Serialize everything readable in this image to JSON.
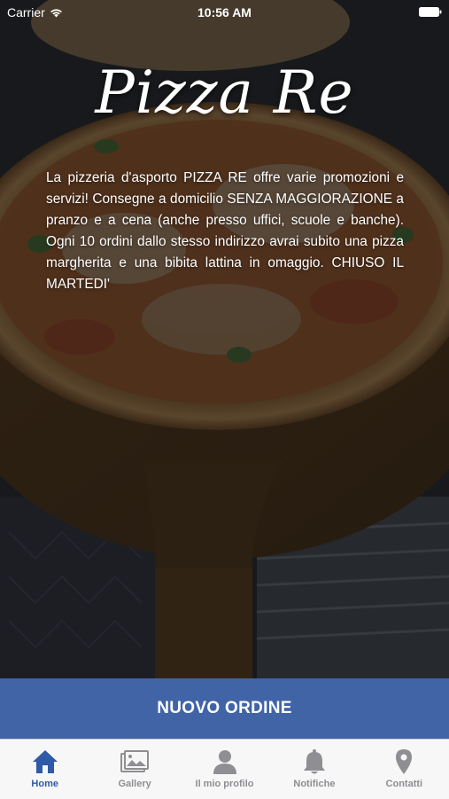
{
  "status_bar": {
    "carrier": "Carrier",
    "time": "10:56 AM"
  },
  "brand": {
    "title": "Pizza Re"
  },
  "description": "La pizzeria d'asporto PIZZA RE offre varie promozioni e servizi! Consegne a domicilio SENZA MAGGIORAZIONE a pranzo e a cena (anche presso uffici, scuole e banche). Ogni 10 ordini dallo stesso indirizzo avrai subito una pizza margherita e una bibita lattina in omaggio. CHIUSO IL MARTEDI'",
  "cta": {
    "label": "NUOVO ORDINE"
  },
  "tabs": [
    {
      "label": "Home",
      "icon": "home-icon",
      "active": true
    },
    {
      "label": "Gallery",
      "icon": "gallery-icon",
      "active": false
    },
    {
      "label": "Il mio profilo",
      "icon": "profile-icon",
      "active": false
    },
    {
      "label": "Notifiche",
      "icon": "bell-icon",
      "active": false
    },
    {
      "label": "Contatti",
      "icon": "location-pin-icon",
      "active": false
    }
  ],
  "colors": {
    "cta_background": "#4164a6",
    "tab_active": "#2f5aa8",
    "tab_inactive": "#8e8e93"
  }
}
